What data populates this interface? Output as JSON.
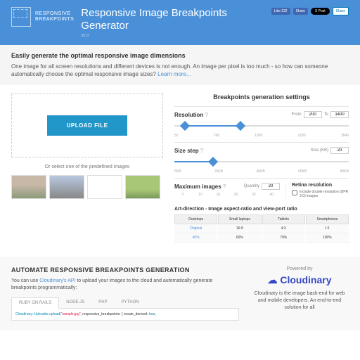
{
  "header": {
    "logo_line1": "RESPONSIVE",
    "logo_line2": "BREAKPOINTS",
    "title": "Responsive Image Breakpoints Generator",
    "version": "v2.0",
    "fb_like": "Like 232",
    "fb_share": "Share",
    "tw_post": "X Post",
    "li_share": "Share"
  },
  "intro": {
    "title": "Easily generate the optimal responsive image dimensions",
    "text": "One image for all screen resolutions and different devices is not enough. An image per pixel is too much - so how can someone automatically choose the optimal responsive image sizes?",
    "learn_more": "Learn more..."
  },
  "upload": {
    "button": "UPLOAD FILE",
    "predefined": "Or select one of the predefined images"
  },
  "settings": {
    "title": "Breakpoints generation settings",
    "resolution": {
      "label": "Resolution",
      "from": "From",
      "to": "To",
      "from_val": "200",
      "to_val": "1400",
      "ticks": [
        "50",
        "768",
        "1080",
        "2180",
        "3840"
      ]
    },
    "size_step": {
      "label": "Size step",
      "unit": "Size (KB)",
      "val": "20",
      "ticks": [
        "5KB",
        "25KB",
        "45KB",
        "65KB",
        "85KB"
      ]
    },
    "max_images": {
      "label": "Maximum images",
      "qty": "Quantity",
      "val": "20",
      "ticks": [
        "3",
        "10",
        "18",
        "25",
        "32",
        "40"
      ]
    },
    "retina": {
      "title": "Retina resolution",
      "checkbox": "Include double resolution (DPR 2.0) images"
    },
    "art": {
      "title": "Art-direction - Image aspect-ratio and view-port ratio",
      "cols": [
        "Desktops",
        "Small laptops",
        "Tablets",
        "Smartphones"
      ],
      "row1": [
        "Original",
        "16:9",
        "4:3",
        "1:1"
      ],
      "row2": [
        "40%",
        "60%",
        "70%",
        "100%"
      ]
    }
  },
  "automate": {
    "title": "AUTOMATE RESPONSIVE BREAKPOINTS GENERATION",
    "text_before": "You can use ",
    "api_link": "Cloudinary's API",
    "text_after": " to upload your images to the cloud and automatically generate breakpoints programmatically:",
    "tabs": [
      "RUBY ON RAILS",
      "NODE.JS",
      "PHP",
      "PYTHON"
    ],
    "code": {
      "c1": "Cloudinary::Uploader.upload(",
      "c2": "\"sample.jpg\"",
      "c3": ", responsive_breakpoints: { create_derived: ",
      "c4": "true",
      "c5": ","
    },
    "powered": "Powered by",
    "cloud_name": "Cloudinary",
    "cloud_desc": "Cloudinary is the image back-end for web and mobile developers. An end-to-end solution for all"
  }
}
